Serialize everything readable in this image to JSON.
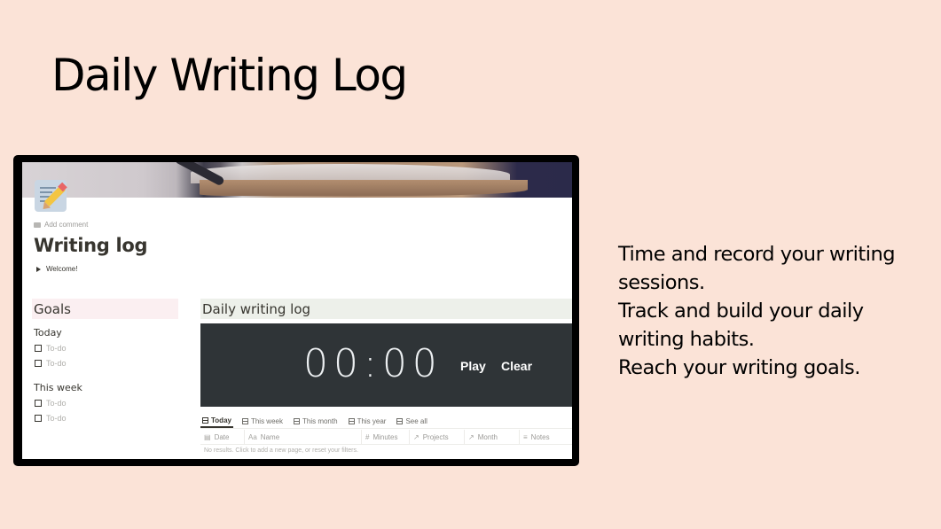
{
  "slide": {
    "title": "Daily Writing Log",
    "description": [
      "Time and record your writing sessions.",
      "Track and build your daily writing habits.",
      "Reach your writing goals."
    ],
    "background_color": "#fbe3d7"
  },
  "notion_page": {
    "icon": "memo-pencil-icon",
    "add_comment": "Add comment",
    "title": "Writing log",
    "toggle_label": "Welcome!",
    "goals": {
      "heading": "Goals",
      "heading_color": "#fbeff1",
      "sections": [
        {
          "label": "Today",
          "todos": [
            "To-do",
            "To-do"
          ]
        },
        {
          "label": "This week",
          "todos": [
            "To-do",
            "To-do"
          ]
        }
      ]
    },
    "log": {
      "heading": "Daily writing log",
      "heading_color": "#edf0ea",
      "timer": {
        "time": "00:00",
        "play_label": "Play",
        "clear_label": "Clear",
        "background": "#2f3437"
      },
      "tabs": [
        {
          "label": "Today",
          "active": true
        },
        {
          "label": "This week",
          "active": false
        },
        {
          "label": "This month",
          "active": false
        },
        {
          "label": "This year",
          "active": false
        },
        {
          "label": "See all",
          "active": false
        }
      ],
      "columns": [
        {
          "icon": "calendar-icon",
          "glyph": "▤",
          "label": "Date"
        },
        {
          "icon": "text-icon",
          "glyph": "Aa",
          "label": "Name"
        },
        {
          "icon": "number-icon",
          "glyph": "#",
          "label": "Minutes"
        },
        {
          "icon": "relation-icon",
          "glyph": "↗",
          "label": "Projects"
        },
        {
          "icon": "relation-icon",
          "glyph": "↗",
          "label": "Month"
        },
        {
          "icon": "text-lines-icon",
          "glyph": "≡",
          "label": "Notes"
        }
      ],
      "empty_message": "No results. Click to add a new page, or reset your filters."
    }
  }
}
